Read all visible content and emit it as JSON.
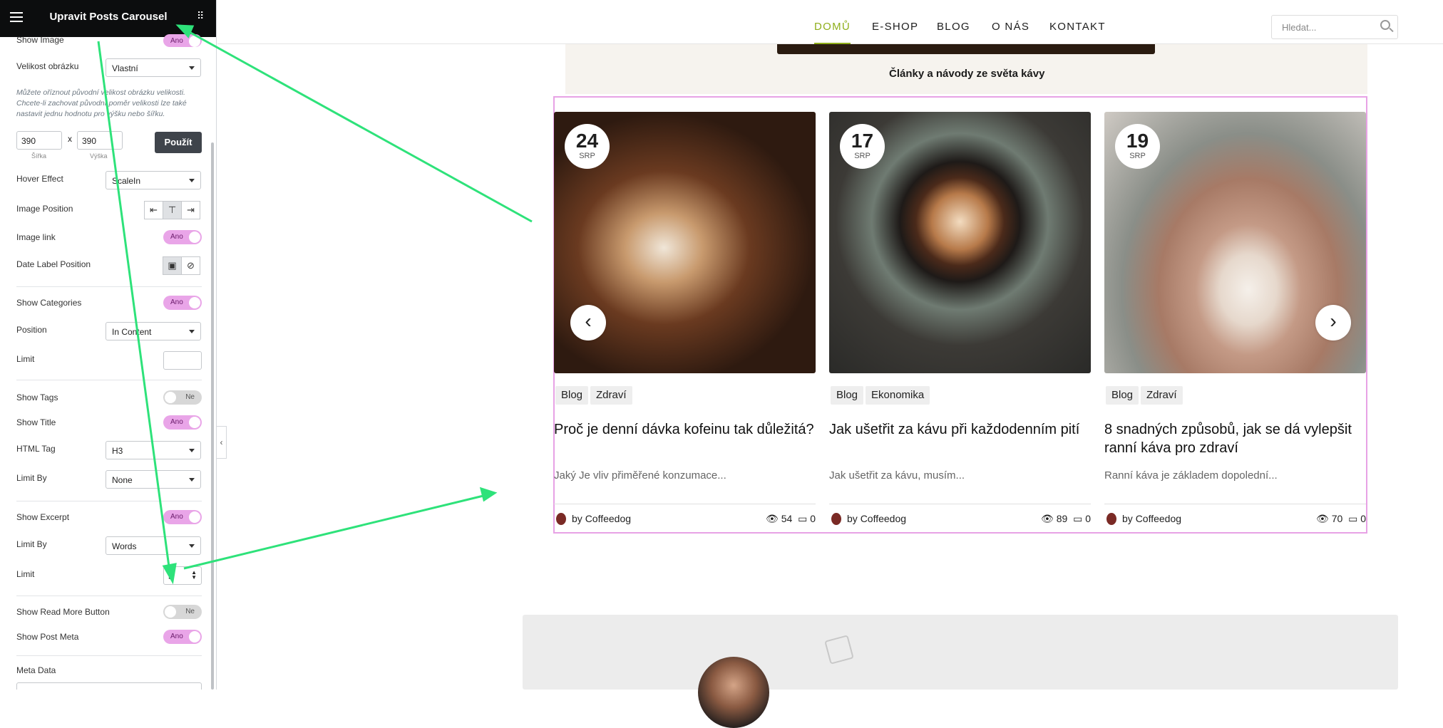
{
  "panel": {
    "title": "Upravit Posts Carousel",
    "hint": "Můžete oříznout původní velikost obrázku velikosti. Chcete-li zachovat původní poměr velikosti lze také nastavit jednu hodnotu pro výšku nebo šířku.",
    "width_value": "390",
    "height_value": "390",
    "x_sep": "x",
    "width_caption": "Šířka",
    "height_caption": "Výška",
    "apply": "Použít",
    "on": "Ano",
    "off": "Ne",
    "meta_data": "Meta Data",
    "limit_value": "5",
    "labels": {
      "show_image": "Show Image",
      "image_size": "Velikost obrázku",
      "hover_effect": "Hover Effect",
      "image_position": "Image Position",
      "image_link": "Image link",
      "date_label_position": "Date Label Position",
      "show_categories": "Show Categories",
      "position": "Position",
      "limit": "Limit",
      "show_tags": "Show Tags",
      "show_title": "Show Title",
      "html_tag": "HTML Tag",
      "limit_by": "Limit By",
      "show_excerpt": "Show Excerpt",
      "limit_by2": "Limit By",
      "limit2": "Limit",
      "show_read_more": "Show Read More Button",
      "show_post_meta": "Show Post Meta"
    },
    "values": {
      "image_size": "Vlastní",
      "hover_effect": "ScaleIn",
      "position": "In Content",
      "html_tag": "H3",
      "limit_by": "None",
      "limit_by2": "Words"
    }
  },
  "nav": {
    "items": [
      "DOMŮ",
      "E-SHOP",
      "BLOG",
      "O NÁS",
      "KONTAKT"
    ],
    "active": "DOMŮ",
    "active_color": "#8fae1b",
    "search_placeholder": "Hledat..."
  },
  "section": {
    "subtitle": "Články a návody ze světa kávy"
  },
  "posts": [
    {
      "day": "24",
      "month": "SRP",
      "cats": [
        "Blog",
        "Zdraví"
      ],
      "title": "Proč je denní dávka kofeinu tak důležitá?",
      "excerpt": "Jaký Je vliv přiměřené konzumace...",
      "author_prefix": "by",
      "author": "Coffeedog",
      "views": "54",
      "comments": "0"
    },
    {
      "day": "17",
      "month": "SRP",
      "cats": [
        "Blog",
        "Ekonomika"
      ],
      "title": "Jak ušetřit za kávu při každodenním pití",
      "excerpt": "Jak ušetřit za kávu, musím...",
      "author_prefix": "by",
      "author": "Coffeedog",
      "views": "89",
      "comments": "0"
    },
    {
      "day": "19",
      "month": "SRP",
      "cats": [
        "Blog",
        "Zdraví"
      ],
      "title": "8 snadných způsobů, jak se dá vylepšit ranní káva pro zdraví",
      "excerpt": "Ranní káva je základem dopolední...",
      "author_prefix": "by",
      "author": "Coffeedog",
      "views": "70",
      "comments": "0"
    }
  ],
  "colors": {
    "accent_pink": "#e9a5e8",
    "arrow_green": "#2ee27a",
    "nav_green": "#8fae1b"
  }
}
